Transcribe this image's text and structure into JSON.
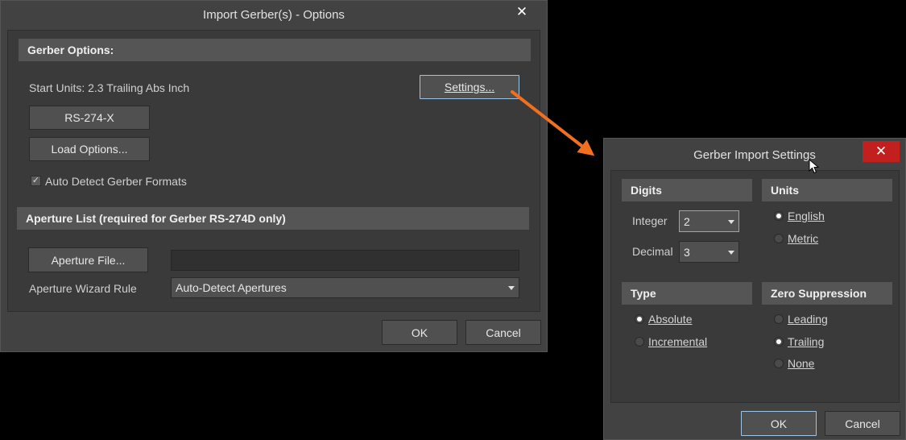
{
  "main_dialog": {
    "title": "Import Gerber(s) - Options",
    "close_glyph": "✕",
    "gerber_options": {
      "header": "Gerber Options:",
      "start_units": "Start Units: 2.3 Trailing Abs Inch",
      "settings_button": "Settings...",
      "rs274x_button": "RS-274-X",
      "load_options_button": "Load Options...",
      "auto_detect_label": "Auto Detect Gerber Formats",
      "auto_detect_checked": true
    },
    "aperture_list": {
      "header": "Aperture List (required for Gerber RS-274D only)",
      "aperture_file_button": "Aperture File...",
      "aperture_file_value": "",
      "wizard_rule_label": "Aperture Wizard Rule",
      "wizard_rule_value": "Auto-Detect Apertures"
    },
    "ok_button": "OK",
    "cancel_button": "Cancel"
  },
  "settings_dialog": {
    "title": "Gerber Import Settings",
    "close_glyph": "✕",
    "close_bg": "#c41f1f",
    "digits": {
      "header": "Digits",
      "integer_label": "Integer",
      "integer_value": "2",
      "decimal_label": "Decimal",
      "decimal_value": "3"
    },
    "units": {
      "header": "Units",
      "options": [
        "English",
        "Metric"
      ],
      "selected": "English"
    },
    "type": {
      "header": "Type",
      "options": [
        "Absolute",
        "Incremental"
      ],
      "selected": "Absolute"
    },
    "zero_suppression": {
      "header": "Zero Suppression",
      "options": [
        "Leading",
        "Trailing",
        "None"
      ],
      "selected": "Trailing"
    },
    "ok_button": "OK",
    "cancel_button": "Cancel"
  },
  "annotation": {
    "arrow_color": "#f07020"
  },
  "icons": {
    "check_glyph": "✓",
    "cursor": "mouse-pointer-icon"
  }
}
